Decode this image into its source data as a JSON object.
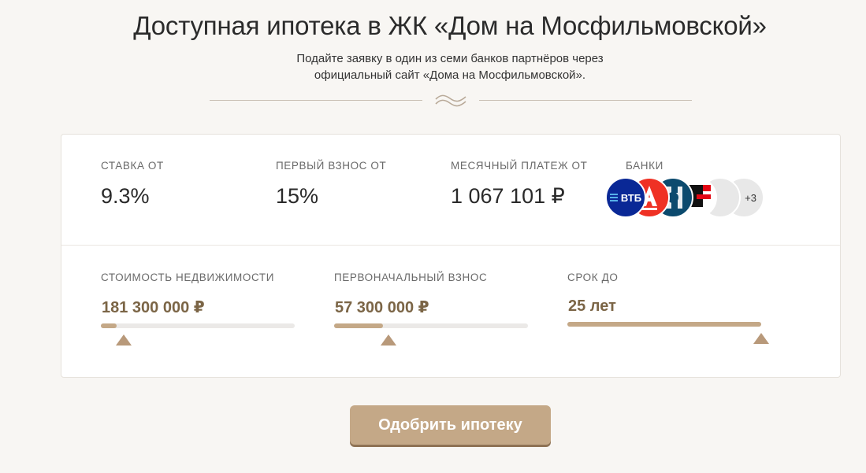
{
  "header": {
    "title": "Доступная ипотека в ЖК «Дом на Мосфильмовской»",
    "subtitle_line1": "Подайте заявку в один из семи банков партнёров через",
    "subtitle_line2": "официальный сайт «Дома на Мосфильмовской»."
  },
  "stats": {
    "rate": {
      "label": "СТАВКА ОТ",
      "value": "9.3%"
    },
    "down": {
      "label": "ПЕРВЫЙ ВЗНОС ОТ",
      "value": "15%"
    },
    "monthly": {
      "label": "МЕСЯЧНЫЙ ПЛАТЕЖ ОТ",
      "value": "1 067 101 ₽"
    },
    "banks": {
      "label": "БАНКИ",
      "more": "+3",
      "vtb_text": "ВТБ"
    }
  },
  "sliders": {
    "price": {
      "label": "СТОИМОСТЬ НЕДВИЖИМОСТИ",
      "value": "181 300 000 ₽",
      "fraction": 0.08
    },
    "initial": {
      "label": "ПЕРВОНАЧАЛЬНЫЙ ВЗНОС",
      "value": "57 300 000 ₽",
      "fraction": 0.25
    },
    "term": {
      "label": "СРОК ДО",
      "value": "25 лет",
      "fraction": 1.0
    }
  },
  "cta": {
    "label": "Одобрить ипотеку"
  },
  "colors": {
    "accent": "#c4a887",
    "value_text": "#7b6546",
    "vtb": "#0a2896",
    "alfa": "#ef3124"
  }
}
